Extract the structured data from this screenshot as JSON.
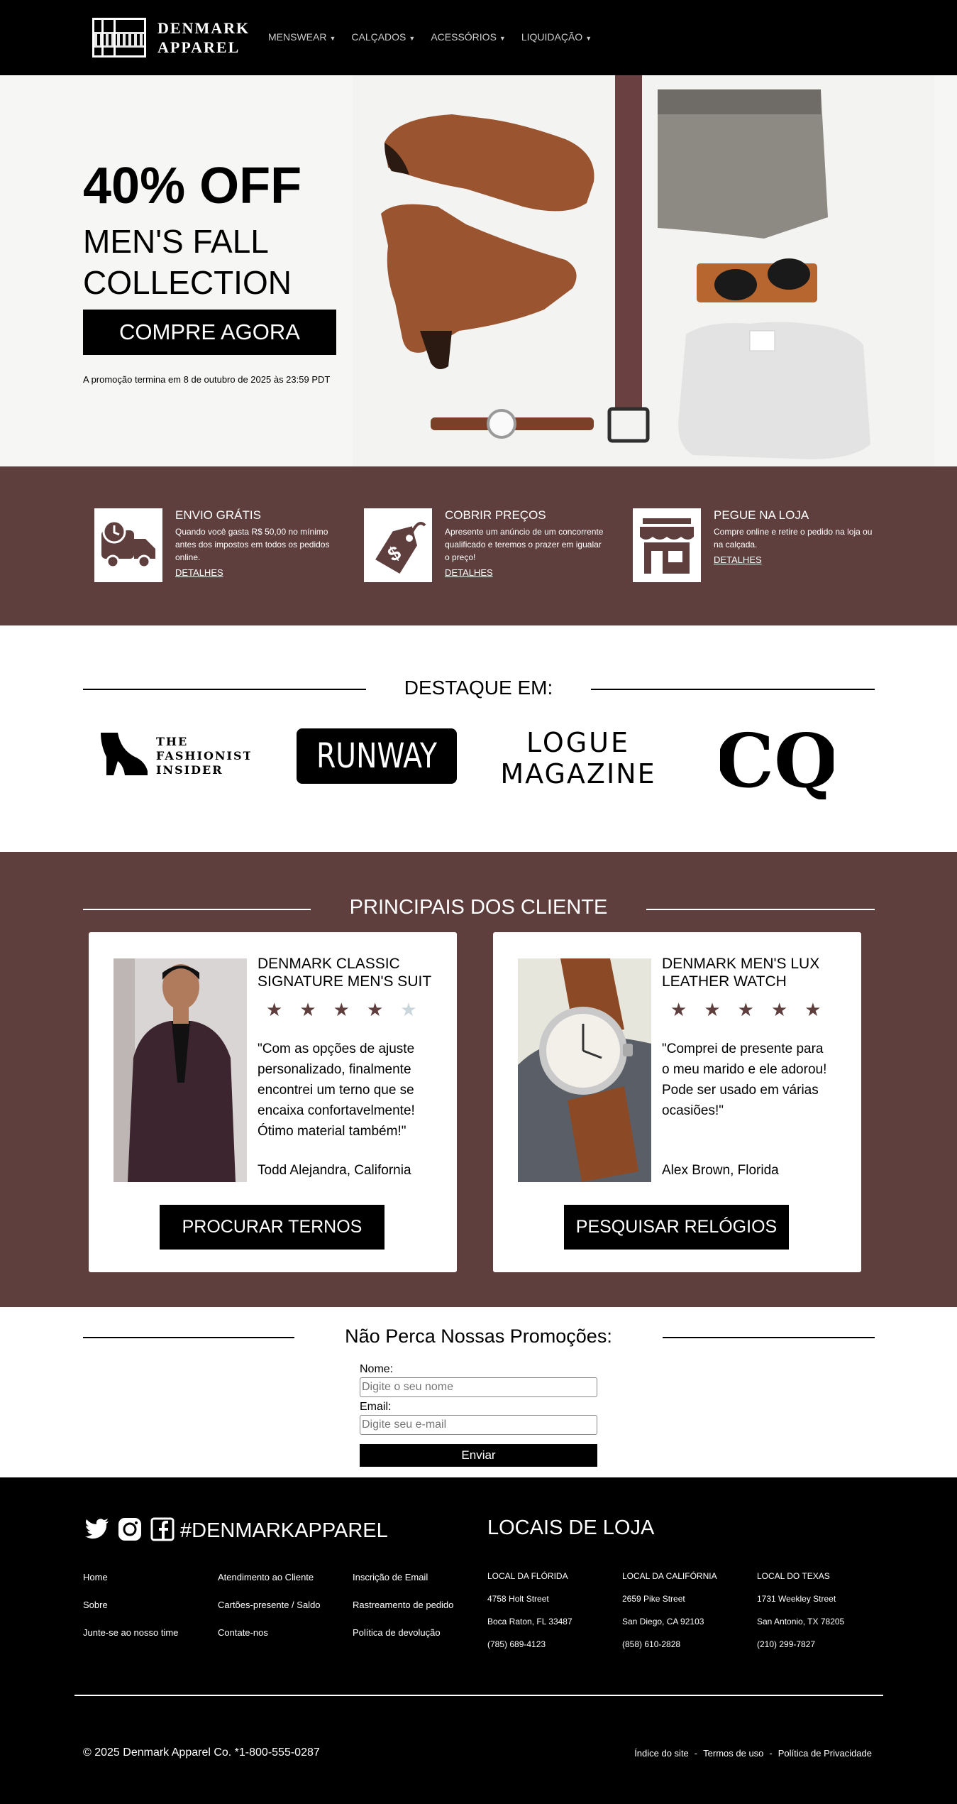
{
  "brand": {
    "line1": "DENMARK",
    "line2": "APPAREL"
  },
  "nav": {
    "items": [
      {
        "label": "MENSWEAR"
      },
      {
        "label": "CALÇADOS"
      },
      {
        "label": "ACESSÓRIOS"
      },
      {
        "label": "LIQUIDAÇÃO"
      }
    ]
  },
  "hero": {
    "headline": "40% OFF",
    "subheadline": "MEN'S FALL COLLECTION",
    "cta": "COMPRE AGORA",
    "note": "A promoção termina em 8 de outubro de 2025 às 23:59 PDT"
  },
  "benefits": [
    {
      "icon": "delivery-truck-icon",
      "title": "ENVIO GRÁTIS",
      "desc": "Quando você gasta R$ 50,00 no mínimo antes dos impostos em todos os pedidos online.",
      "link": "DETALHES"
    },
    {
      "icon": "price-tag-icon",
      "title": "COBRIR PREÇOS",
      "desc": "Apresente um anúncio de um concorrente qualificado e teremos o prazer em igualar o preço!",
      "link": "DETALHES"
    },
    {
      "icon": "storefront-icon",
      "title": "PEGUE NA LOJA",
      "desc": "Compre online e retire o pedido na loja ou na calçada.",
      "link": "DETALHES"
    }
  ],
  "featured": {
    "heading": "DESTAQUE EM:",
    "logos": [
      {
        "name": "THE FASHIONISTA INSIDER",
        "lines": [
          "THE",
          "FASHIONISTA",
          "INSIDER"
        ]
      },
      {
        "name": "RUNWAY"
      },
      {
        "name": "LOGUE MAGAZINE",
        "lines": [
          "LOGUE",
          "MAGAZINE"
        ]
      },
      {
        "name": "CQ"
      }
    ]
  },
  "testimonials": {
    "heading": "PRINCIPAIS DOS CLIENTE",
    "cards": [
      {
        "title": "DENMARK CLASSIC SIGNATURE MEN'S SUIT",
        "rating": 4,
        "quote": "\"Com as opções de ajuste personalizado, finalmente encontrei um terno que se encaixa confortavelmente! Ótimo material também!\"",
        "author": "Todd Alejandra, California",
        "cta": "PROCURAR TERNOS"
      },
      {
        "title": "DENMARK MEN'S LUX LEATHER WATCH",
        "rating": 5,
        "quote": "\"Comprei de presente para o meu marido e ele adorou! Pode ser usado em várias ocasiões!\"",
        "author": "Alex Brown, Florida",
        "cta": "PESQUISAR RELÓGIOS"
      }
    ]
  },
  "newsletter": {
    "heading": "Não Perca Nossas Promoções:",
    "name_label": "Nome:",
    "name_placeholder": "Digite o seu nome",
    "email_label": "Email:",
    "email_placeholder": "Digite seu e-mail",
    "submit": "Enviar"
  },
  "footer": {
    "hashtag": "#DENMARKAPPAREL",
    "links": [
      "Home",
      "Atendimento ao Cliente",
      "Inscrição de Email",
      "Sobre",
      "Cartões-presente / Saldo",
      "Rastreamento de pedido",
      "Junte-se ao nosso time",
      "Contate-nos",
      "Política de devolução"
    ],
    "stores_title": "LOCAIS DE LOJA",
    "stores": [
      {
        "name": "LOCAL DA FLÓRIDA",
        "street": "4758 Holt Street",
        "city": "Boca Raton, FL 33487",
        "phone": "(785) 689-4123"
      },
      {
        "name": "LOCAL DA CALIFÓRNIA",
        "street": "2659 Pike Street",
        "city": "San Diego, CA 92103",
        "phone": "(858) 610-2828"
      },
      {
        "name": "LOCAL DO TEXAS",
        "street": "1731 Weekley Street",
        "city": "San Antonio, TX 78205",
        "phone": "(210) 299-7827"
      }
    ],
    "copyright": "© 2025 Denmark Apparel Co. *1-800-555-0287",
    "legal": [
      "Índice do site",
      "Termos de uso",
      "Política de Privacidade"
    ]
  },
  "colors": {
    "accent": "#5e3f3d",
    "dark": "#000000",
    "star_off": "#c9d6dc"
  }
}
